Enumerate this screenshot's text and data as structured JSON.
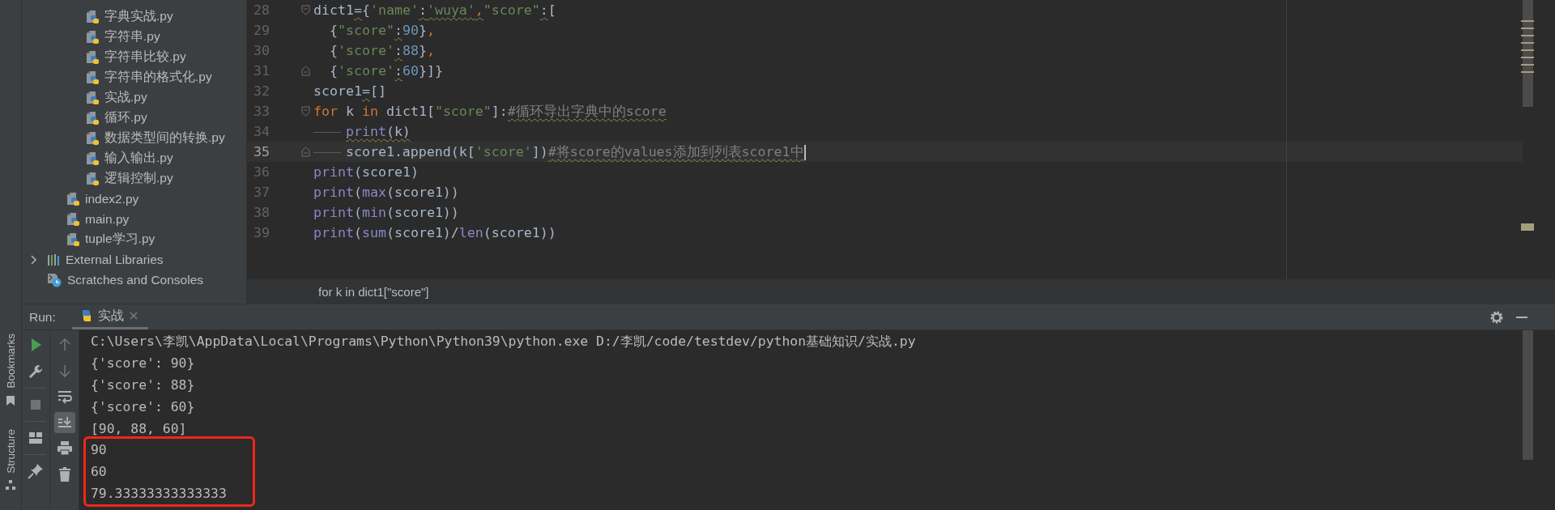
{
  "tool_windows": [
    {
      "label": "Bookmarks",
      "kind": "bookmarks"
    },
    {
      "label": "Structure",
      "kind": "structure"
    }
  ],
  "project_tree": [
    {
      "children": [
        {
          "children": [
            {
              "label": "字典实战.py",
              "kind": "python"
            },
            {
              "label": "字符串.py",
              "kind": "python"
            },
            {
              "label": "字符串比较.py",
              "kind": "python"
            },
            {
              "label": "字符串的格式化.py",
              "kind": "python"
            },
            {
              "label": "实战.py",
              "kind": "python"
            },
            {
              "label": "循环.py",
              "kind": "python"
            },
            {
              "label": "数据类型间的转换.py",
              "kind": "python"
            },
            {
              "label": "输入输出.py",
              "kind": "python"
            },
            {
              "label": "逻辑控制.py",
              "kind": "python"
            }
          ]
        },
        {
          "label": "index2.py",
          "kind": "python"
        },
        {
          "label": "main.py",
          "kind": "python"
        },
        {
          "label": "tuple学习.py",
          "kind": "python"
        }
      ]
    },
    {
      "label": "External Libraries",
      "kind": "library",
      "expanded": false
    },
    {
      "label": "Scratches and Consoles",
      "kind": "scratch"
    }
  ],
  "editor": {
    "lines": [
      {
        "number": "28",
        "fold": {
          "kind": "open"
        },
        "current": false,
        "tabbed": false,
        "tokens": [
          {
            "text": "dict1",
            "kind": "plain",
            "warn": false
          },
          {
            "text": "=",
            "kind": "plain",
            "warn": true
          },
          {
            "text": "{",
            "kind": "plain",
            "warn": false
          },
          {
            "text": "'name'",
            "kind": "string",
            "warn": false
          },
          {
            "text": ":",
            "kind": "plain",
            "warn": true
          },
          {
            "text": "'wuya'",
            "kind": "string",
            "warn": true
          },
          {
            "text": ",",
            "kind": "keyword",
            "warn": true
          },
          {
            "text": "\"score\"",
            "kind": "string",
            "warn": false
          },
          {
            "text": ":",
            "kind": "plain",
            "warn": true
          },
          {
            "text": "[",
            "kind": "plain",
            "warn": false
          }
        ]
      },
      {
        "number": "29",
        "current": false,
        "tabbed": false,
        "tokens": [
          {
            "text": "  {",
            "kind": "plain",
            "warn": false
          },
          {
            "text": "\"score\"",
            "kind": "string",
            "warn": false
          },
          {
            "text": ":",
            "kind": "plain",
            "warn": true
          },
          {
            "text": "90",
            "kind": "number",
            "warn": false
          },
          {
            "text": "}",
            "kind": "plain",
            "warn": false
          },
          {
            "text": ",",
            "kind": "keyword",
            "warn": false
          }
        ]
      },
      {
        "number": "30",
        "current": false,
        "tabbed": false,
        "tokens": [
          {
            "text": "  {",
            "kind": "plain",
            "warn": false
          },
          {
            "text": "'score'",
            "kind": "string",
            "warn": false
          },
          {
            "text": ":",
            "kind": "plain",
            "warn": true
          },
          {
            "text": "88",
            "kind": "number",
            "warn": false
          },
          {
            "text": "}",
            "kind": "plain",
            "warn": false
          },
          {
            "text": ",",
            "kind": "keyword",
            "warn": false
          }
        ]
      },
      {
        "number": "31",
        "fold": {
          "kind": "close"
        },
        "current": false,
        "tabbed": false,
        "tokens": [
          {
            "text": "  {",
            "kind": "plain",
            "warn": false
          },
          {
            "text": "'score'",
            "kind": "string",
            "warn": false
          },
          {
            "text": ":",
            "kind": "plain",
            "warn": true
          },
          {
            "text": "60",
            "kind": "number",
            "warn": false
          },
          {
            "text": "}]}",
            "kind": "plain",
            "warn": false
          }
        ]
      },
      {
        "number": "32",
        "current": false,
        "tabbed": false,
        "tokens": [
          {
            "text": "score1",
            "kind": "plain",
            "warn": false
          },
          {
            "text": "=",
            "kind": "plain",
            "warn": true
          },
          {
            "text": "[]",
            "kind": "plain",
            "warn": false
          }
        ]
      },
      {
        "number": "33",
        "fold": {
          "kind": "open"
        },
        "current": false,
        "tabbed": false,
        "tokens": [
          {
            "text": "for",
            "kind": "keyword",
            "warn": false
          },
          {
            "text": " k ",
            "kind": "plain",
            "warn": false
          },
          {
            "text": "in",
            "kind": "keyword",
            "warn": false
          },
          {
            "text": " dict1[",
            "kind": "plain",
            "warn": false
          },
          {
            "text": "\"score\"",
            "kind": "string",
            "warn": false
          },
          {
            "text": "]:",
            "kind": "plain",
            "warn": false
          },
          {
            "text": "#循环导出字典中的score",
            "kind": "comment",
            "warn": true
          }
        ]
      },
      {
        "number": "34",
        "current": false,
        "tabbed": true,
        "tokens": [
          {
            "text": "print",
            "kind": "builtin",
            "warn": true
          },
          {
            "text": "(k)",
            "kind": "plain",
            "warn": true
          }
        ]
      },
      {
        "number": "35",
        "fold": {
          "kind": "close"
        },
        "current": true,
        "tabbed": true,
        "tokens": [
          {
            "text": "score1.append(k[",
            "kind": "plain",
            "warn": false
          },
          {
            "text": "'score'",
            "kind": "string",
            "warn": false
          },
          {
            "text": "])",
            "kind": "plain",
            "warn": false
          },
          {
            "text": "#将score的values添加到列表score1中",
            "kind": "comment",
            "warn": true
          }
        ]
      },
      {
        "number": "36",
        "current": false,
        "tabbed": false,
        "tokens": [
          {
            "text": "print",
            "kind": "builtin",
            "warn": false
          },
          {
            "text": "(score1)",
            "kind": "plain",
            "warn": false
          }
        ]
      },
      {
        "number": "37",
        "current": false,
        "tabbed": false,
        "tokens": [
          {
            "text": "print",
            "kind": "builtin",
            "warn": false
          },
          {
            "text": "(",
            "kind": "plain",
            "warn": false
          },
          {
            "text": "max",
            "kind": "builtin",
            "warn": false
          },
          {
            "text": "(score1))",
            "kind": "plain",
            "warn": false
          }
        ]
      },
      {
        "number": "38",
        "current": false,
        "tabbed": false,
        "tokens": [
          {
            "text": "print",
            "kind": "builtin",
            "warn": false
          },
          {
            "text": "(",
            "kind": "plain",
            "warn": false
          },
          {
            "text": "min",
            "kind": "builtin",
            "warn": false
          },
          {
            "text": "(score1))",
            "kind": "plain",
            "warn": false
          }
        ]
      },
      {
        "number": "39",
        "current": false,
        "tabbed": false,
        "tokens": [
          {
            "text": "print",
            "kind": "builtin",
            "warn": false
          },
          {
            "text": "(",
            "kind": "plain",
            "warn": false
          },
          {
            "text": "sum",
            "kind": "builtin",
            "warn": false
          },
          {
            "text": "(score1)/",
            "kind": "plain",
            "warn": false
          },
          {
            "text": "len",
            "kind": "builtin",
            "warn": false
          },
          {
            "text": "(score1))",
            "kind": "plain",
            "warn": false
          }
        ]
      }
    ],
    "breadcrumb": "for k in dict1[\"score\"]"
  },
  "run": {
    "label": "Run:",
    "tabs": [
      {
        "label": "实战",
        "selected": true
      }
    ],
    "left_tools": [
      {
        "kind": "rerun",
        "disabled": false
      },
      {
        "kind": "wrench",
        "disabled": false
      },
      {
        "kind": "stop",
        "disabled": true
      },
      {
        "kind": "layout",
        "disabled": false
      },
      {
        "kind": "pin",
        "disabled": false
      }
    ],
    "right_tools": [
      {
        "kind": "up",
        "disabled": true,
        "selected": false
      },
      {
        "kind": "down",
        "disabled": true,
        "selected": false
      },
      {
        "kind": "wrap",
        "disabled": false,
        "selected": false
      },
      {
        "kind": "scroll-end",
        "disabled": false,
        "selected": true
      },
      {
        "kind": "print",
        "disabled": false,
        "selected": false
      },
      {
        "kind": "trash",
        "disabled": false,
        "selected": false
      }
    ],
    "output": [
      {
        "text": "C:\\Users\\李凯\\AppData\\Local\\Programs\\Python\\Python39\\python.exe D:/李凯/code/testdev/python基础知识/实战.py",
        "boxed": false
      },
      {
        "text": "{'score': 90}",
        "boxed": false
      },
      {
        "text": "{'score': 88}",
        "boxed": false
      },
      {
        "text": "{'score': 60}",
        "boxed": false
      },
      {
        "text": "[90, 88, 60]",
        "boxed": false
      },
      {
        "text": "90",
        "boxed": true
      },
      {
        "text": "60",
        "boxed": true
      },
      {
        "text": "79.33333333333333",
        "boxed": true
      }
    ]
  }
}
